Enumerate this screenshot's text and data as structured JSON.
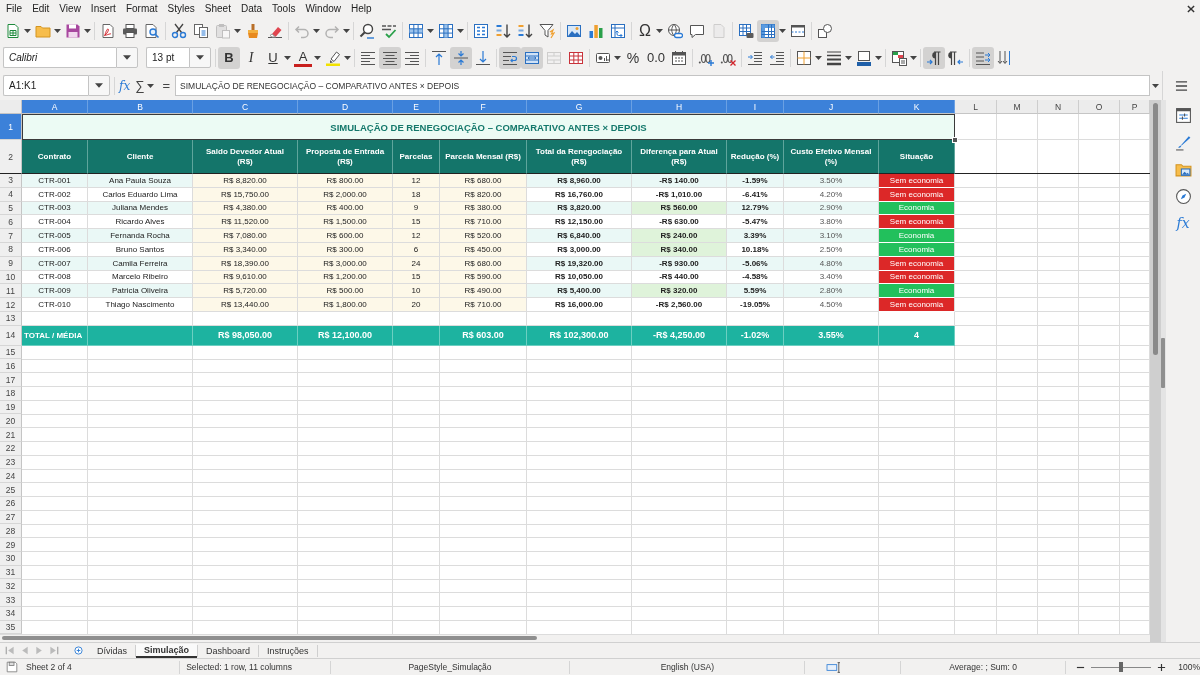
{
  "menu_bar": [
    "File",
    "Edit",
    "View",
    "Insert",
    "Format",
    "Styles",
    "Sheet",
    "Data",
    "Tools",
    "Window",
    "Help"
  ],
  "standard_toolbar": {
    "groups": [
      [
        {
          "kind": "new",
          "dropdown": true,
          "on": false,
          "disabled": false
        },
        {
          "kind": "open",
          "dropdown": true,
          "on": false,
          "disabled": false
        },
        {
          "kind": "save",
          "dropdown": true,
          "on": false,
          "disabled": false
        }
      ],
      [
        {
          "kind": "pdf",
          "on": false,
          "disabled": false
        },
        {
          "kind": "print",
          "on": false,
          "disabled": false
        },
        {
          "kind": "preview",
          "on": false,
          "disabled": false
        }
      ],
      [
        {
          "kind": "cut",
          "on": false,
          "disabled": false
        },
        {
          "kind": "copy",
          "on": false,
          "disabled": false
        },
        {
          "kind": "paste",
          "dropdown": true,
          "on": false,
          "disabled": true
        },
        {
          "kind": "clone",
          "on": false,
          "disabled": false
        },
        {
          "kind": "clear",
          "on": false,
          "disabled": false
        }
      ],
      [
        {
          "kind": "undo",
          "dropdown": true,
          "on": false,
          "disabled": true
        },
        {
          "kind": "redo",
          "dropdown": true,
          "on": false,
          "disabled": true
        }
      ],
      [
        {
          "kind": "find",
          "on": false,
          "disabled": false
        },
        {
          "kind": "spelling",
          "on": false,
          "disabled": false
        }
      ],
      [
        {
          "kind": "rows",
          "dropdown": true,
          "on": false,
          "disabled": false
        },
        {
          "kind": "columns",
          "dropdown": true,
          "on": false,
          "disabled": false
        }
      ],
      [
        {
          "kind": "sort",
          "on": false,
          "disabled": false
        },
        {
          "kind": "sort_asc",
          "on": false,
          "disabled": false
        },
        {
          "kind": "sort_desc",
          "on": false,
          "disabled": false
        },
        {
          "kind": "autofilter",
          "on": false,
          "disabled": false
        }
      ],
      [
        {
          "kind": "image",
          "on": false,
          "disabled": false
        },
        {
          "kind": "chart",
          "on": false,
          "disabled": false
        },
        {
          "kind": "pivot",
          "on": false,
          "disabled": false
        }
      ],
      [
        {
          "kind": "special_character",
          "label": "Ω",
          "dropdown": true,
          "on": false,
          "disabled": false
        },
        {
          "kind": "hyperlink",
          "on": false,
          "disabled": false
        },
        {
          "kind": "comment",
          "on": false,
          "disabled": false
        },
        {
          "kind": "header_footer",
          "on": false,
          "disabled": true
        }
      ],
      [
        {
          "kind": "print_area",
          "on": false,
          "disabled": false
        },
        {
          "kind": "freeze",
          "dropdown": true,
          "on": true,
          "disabled": false
        },
        {
          "kind": "split",
          "on": false,
          "disabled": false
        }
      ],
      [
        {
          "kind": "draw",
          "on": false,
          "disabled": false
        }
      ]
    ]
  },
  "formatting_toolbar": {
    "font_name": "Calibri",
    "font_size": "13 pt",
    "groups": [
      [
        {
          "kind": "bold",
          "label": "B",
          "on": true,
          "disabled": false
        },
        {
          "kind": "italic",
          "label": "I",
          "on": false,
          "disabled": false
        },
        {
          "kind": "underline",
          "label": "U",
          "dropdown": true,
          "on": false,
          "disabled": false
        },
        {
          "kind": "font_color",
          "label": "A",
          "dropdown": true,
          "on": false,
          "disabled": false
        },
        {
          "kind": "highlight",
          "dropdown": true,
          "on": false,
          "disabled": false
        }
      ],
      [
        {
          "kind": "align_left",
          "on": false,
          "disabled": false
        },
        {
          "kind": "align_center",
          "on": true,
          "disabled": false
        },
        {
          "kind": "align_right",
          "on": false,
          "disabled": false
        }
      ],
      [
        {
          "kind": "align_top",
          "on": false,
          "disabled": false
        },
        {
          "kind": "align_middle",
          "on": true,
          "disabled": false
        },
        {
          "kind": "align_bottom",
          "on": false,
          "disabled": false
        }
      ],
      [
        {
          "kind": "wrap",
          "on": true,
          "disabled": false
        },
        {
          "kind": "merge_center",
          "on": true,
          "disabled": false
        },
        {
          "kind": "merge",
          "on": false,
          "disabled": true
        },
        {
          "kind": "unmerge",
          "on": false,
          "disabled": false
        }
      ],
      [
        {
          "kind": "currency",
          "dropdown": true,
          "on": false,
          "disabled": false
        },
        {
          "kind": "percent",
          "label": "%",
          "on": false,
          "disabled": false
        },
        {
          "kind": "number",
          "label": "0.0",
          "on": false,
          "disabled": false
        },
        {
          "kind": "date",
          "on": false,
          "disabled": false
        }
      ],
      [
        {
          "kind": "add_decimal",
          "on": false,
          "disabled": false
        },
        {
          "kind": "delete_decimal",
          "on": false,
          "disabled": false
        }
      ],
      [
        {
          "kind": "indent_more",
          "on": false,
          "disabled": false
        },
        {
          "kind": "indent_less",
          "on": false,
          "disabled": false
        }
      ],
      [
        {
          "kind": "borders",
          "dropdown": true,
          "on": false,
          "disabled": false
        },
        {
          "kind": "border_style",
          "dropdown": true,
          "on": false,
          "disabled": false
        },
        {
          "kind": "border_color",
          "dropdown": true,
          "on": false,
          "disabled": false
        }
      ],
      [
        {
          "kind": "conditional",
          "dropdown": true,
          "on": false,
          "disabled": false
        }
      ],
      [
        {
          "kind": "ltr",
          "on": true,
          "disabled": false
        },
        {
          "kind": "rtl",
          "on": false,
          "disabled": false
        }
      ],
      [
        {
          "kind": "text_ltr",
          "on": true,
          "disabled": false
        },
        {
          "kind": "vertical_text",
          "on": false,
          "disabled": false
        }
      ]
    ]
  },
  "formula_bar": {
    "name_box": "A1:K1",
    "function_wizard": "fx",
    "sum": "∑",
    "equals": "=",
    "content": "SIMULAÇÃO DE RENEGOCIAÇÃO – COMPARATIVO ANTES × DEPOIS"
  },
  "sidebar": {
    "functions": "fx"
  },
  "columns": [
    {
      "label": "A",
      "selected": true
    },
    {
      "label": "B",
      "selected": true
    },
    {
      "label": "C",
      "selected": true
    },
    {
      "label": "D",
      "selected": true
    },
    {
      "label": "E",
      "selected": true
    },
    {
      "label": "F",
      "selected": true
    },
    {
      "label": "G",
      "selected": true
    },
    {
      "label": "H",
      "selected": true
    },
    {
      "label": "I",
      "selected": true
    },
    {
      "label": "J",
      "selected": true
    },
    {
      "label": "K",
      "selected": true
    },
    {
      "label": "L",
      "selected": false
    },
    {
      "label": "M",
      "selected": false
    },
    {
      "label": "N",
      "selected": false
    },
    {
      "label": "O",
      "selected": false
    },
    {
      "label": "P",
      "selected": false
    }
  ],
  "row_headers": [
    {
      "label": "1",
      "selected": true
    },
    {
      "label": "2",
      "selected": false
    },
    {
      "label": "3",
      "selected": false
    },
    {
      "label": "4",
      "selected": false
    },
    {
      "label": "5",
      "selected": false
    },
    {
      "label": "6",
      "selected": false
    },
    {
      "label": "7",
      "selected": false
    },
    {
      "label": "8",
      "selected": false
    },
    {
      "label": "9",
      "selected": false
    },
    {
      "label": "10",
      "selected": false
    },
    {
      "label": "11",
      "selected": false
    },
    {
      "label": "12",
      "selected": false
    },
    {
      "label": "13",
      "selected": false
    },
    {
      "label": "14",
      "selected": false
    },
    {
      "label": "15",
      "selected": false
    },
    {
      "label": "16",
      "selected": false
    },
    {
      "label": "17",
      "selected": false
    },
    {
      "label": "18",
      "selected": false
    },
    {
      "label": "19",
      "selected": false
    },
    {
      "label": "20",
      "selected": false
    },
    {
      "label": "21",
      "selected": false
    },
    {
      "label": "22",
      "selected": false
    },
    {
      "label": "23",
      "selected": false
    },
    {
      "label": "24",
      "selected": false
    },
    {
      "label": "25",
      "selected": false
    },
    {
      "label": "26",
      "selected": false
    },
    {
      "label": "27",
      "selected": false
    },
    {
      "label": "28",
      "selected": false
    },
    {
      "label": "29",
      "selected": false
    },
    {
      "label": "30",
      "selected": false
    },
    {
      "label": "31",
      "selected": false
    },
    {
      "label": "32",
      "selected": false
    },
    {
      "label": "33",
      "selected": false
    },
    {
      "label": "34",
      "selected": false
    },
    {
      "label": "35",
      "selected": false
    }
  ],
  "table": {
    "title": "SIMULAÇÃO DE RENEGOCIAÇÃO – COMPARATIVO ANTES × DEPOIS",
    "header": [
      "Contrato",
      "Cliente",
      "Saldo Devedor Atual\n(R$)",
      "Proposta de Entrada\n(R$)",
      "Parcelas",
      "Parcela Mensal (R$)",
      "Total da Renegociação\n(R$)",
      "Diferença para Atual\n(R$)",
      "Redução (%)",
      "Custo Efetivo Mensal\n(%)",
      "Situação"
    ],
    "rows": [
      {
        "contrato": "CTR-001",
        "cliente": "Ana Paula Souza",
        "saldo": "R$ 8,820.00",
        "entrada": "R$ 800.00",
        "parcelas": "12",
        "parcela_mensal": "R$ 680.00",
        "total": "R$ 8,960.00",
        "diferenca": "-R$ 140.00",
        "reducao": "-1.59%",
        "custo": "3.50%",
        "situacao": "Sem economia",
        "saving": false,
        "color": "#dc2828"
      },
      {
        "contrato": "CTR-002",
        "cliente": "Carlos Eduardo Lima",
        "saldo": "R$ 15,750.00",
        "entrada": "R$ 2,000.00",
        "parcelas": "18",
        "parcela_mensal": "R$ 820.00",
        "total": "R$ 16,760.00",
        "diferenca": "-R$ 1,010.00",
        "reducao": "-6.41%",
        "custo": "4.20%",
        "situacao": "Sem economia",
        "saving": false,
        "color": "#dc2828"
      },
      {
        "contrato": "CTR-003",
        "cliente": "Juliana Mendes",
        "saldo": "R$ 4,380.00",
        "entrada": "R$ 400.00",
        "parcelas": "9",
        "parcela_mensal": "R$ 380.00",
        "total": "R$ 3,820.00",
        "diferenca": "R$ 560.00",
        "reducao": "12.79%",
        "custo": "2.90%",
        "situacao": "Economia",
        "saving": true,
        "color": "#22c05c"
      },
      {
        "contrato": "CTR-004",
        "cliente": "Ricardo Alves",
        "saldo": "R$ 11,520.00",
        "entrada": "R$ 1,500.00",
        "parcelas": "15",
        "parcela_mensal": "R$ 710.00",
        "total": "R$ 12,150.00",
        "diferenca": "-R$ 630.00",
        "reducao": "-5.47%",
        "custo": "3.80%",
        "situacao": "Sem economia",
        "saving": false,
        "color": "#dc2828"
      },
      {
        "contrato": "CTR-005",
        "cliente": "Fernanda Rocha",
        "saldo": "R$ 7,080.00",
        "entrada": "R$ 600.00",
        "parcelas": "12",
        "parcela_mensal": "R$ 520.00",
        "total": "R$ 6,840.00",
        "diferenca": "R$ 240.00",
        "reducao": "3.39%",
        "custo": "3.10%",
        "situacao": "Economia",
        "saving": true,
        "color": "#22c05c"
      },
      {
        "contrato": "CTR-006",
        "cliente": "Bruno Santos",
        "saldo": "R$ 3,340.00",
        "entrada": "R$ 300.00",
        "parcelas": "6",
        "parcela_mensal": "R$ 450.00",
        "total": "R$ 3,000.00",
        "diferenca": "R$ 340.00",
        "reducao": "10.18%",
        "custo": "2.50%",
        "situacao": "Economia",
        "saving": true,
        "color": "#22c05c"
      },
      {
        "contrato": "CTR-007",
        "cliente": "Camila Ferreira",
        "saldo": "R$ 18,390.00",
        "entrada": "R$ 3,000.00",
        "parcelas": "24",
        "parcela_mensal": "R$ 680.00",
        "total": "R$ 19,320.00",
        "diferenca": "-R$ 930.00",
        "reducao": "-5.06%",
        "custo": "4.80%",
        "situacao": "Sem economia",
        "saving": false,
        "color": "#dc2828"
      },
      {
        "contrato": "CTR-008",
        "cliente": "Marcelo Ribeiro",
        "saldo": "R$ 9,610.00",
        "entrada": "R$ 1,200.00",
        "parcelas": "15",
        "parcela_mensal": "R$ 590.00",
        "total": "R$ 10,050.00",
        "diferenca": "-R$ 440.00",
        "reducao": "-4.58%",
        "custo": "3.40%",
        "situacao": "Sem economia",
        "saving": false,
        "color": "#dc2828"
      },
      {
        "contrato": "CTR-009",
        "cliente": "Patricia Oliveira",
        "saldo": "R$ 5,720.00",
        "entrada": "R$ 500.00",
        "parcelas": "10",
        "parcela_mensal": "R$ 490.00",
        "total": "R$ 5,400.00",
        "diferenca": "R$ 320.00",
        "reducao": "5.59%",
        "custo": "2.80%",
        "situacao": "Economia",
        "saving": true,
        "color": "#22c05c"
      },
      {
        "contrato": "CTR-010",
        "cliente": "Thiago Nascimento",
        "saldo": "R$ 13,440.00",
        "entrada": "R$ 1,800.00",
        "parcelas": "20",
        "parcela_mensal": "R$ 710.00",
        "total": "R$ 16,000.00",
        "diferenca": "-R$ 2,560.00",
        "reducao": "-19.05%",
        "custo": "4.50%",
        "situacao": "Sem economia",
        "saving": false,
        "color": "#dc2828"
      }
    ],
    "total": {
      "label": "TOTAL / MÉDIA",
      "saldo": "R$ 98,050.00",
      "entrada": "R$ 12,100.00",
      "parcela_mensal": "R$ 603.00",
      "total": "R$ 102,300.00",
      "diferenca": "-R$ 4,250.00",
      "reducao": "-1.02%",
      "custo": "3.55%",
      "situacao": "4"
    }
  },
  "sheet_tabs": [
    {
      "label": "Dívidas",
      "selected": false
    },
    {
      "label": "Simulação",
      "selected": true
    },
    {
      "label": "Dashboard",
      "selected": false
    },
    {
      "label": "Instruções",
      "selected": false
    }
  ],
  "status_bar": {
    "sheet": "Sheet 2 of 4",
    "selection": "Selected: 1 row, 11 columns",
    "page_style": "PageStyle_Simulação",
    "language": "English (USA)",
    "summary": "Average: ; Sum: 0",
    "zoom": {
      "level": 0.5,
      "reading": "100%"
    }
  }
}
